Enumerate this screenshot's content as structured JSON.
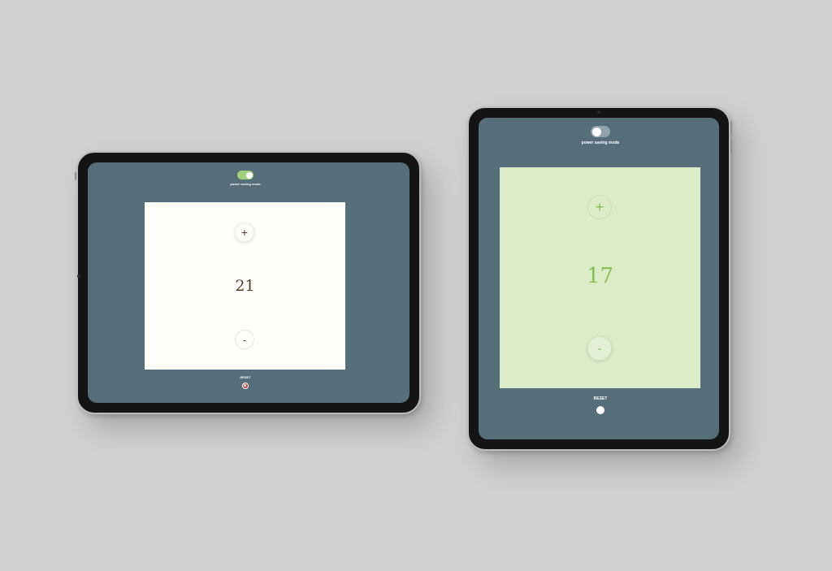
{
  "tablets": [
    {
      "id": "landscape",
      "power_saving_label": "power saving mode",
      "power_saving_on": true,
      "increment_label": "+",
      "count": "21",
      "decrement_label": "-",
      "reset_label": "RESET",
      "reset_icon": "close-icon"
    },
    {
      "id": "portrait",
      "power_saving_label": "power saving mode",
      "power_saving_on": false,
      "increment_label": "+",
      "count": "17",
      "decrement_label": "-",
      "reset_label": "RESET",
      "reset_icon": "circle-icon"
    }
  ],
  "colors": {
    "background": "#d1d1d1",
    "screen": "#566d7a",
    "toggle_on": "#9fd27a",
    "panel_light": "#fffff9",
    "panel_green": "#dcecc9",
    "count_brown": "#5a3a30",
    "count_green": "#83bf4f",
    "reset_red": "#c0393b"
  }
}
